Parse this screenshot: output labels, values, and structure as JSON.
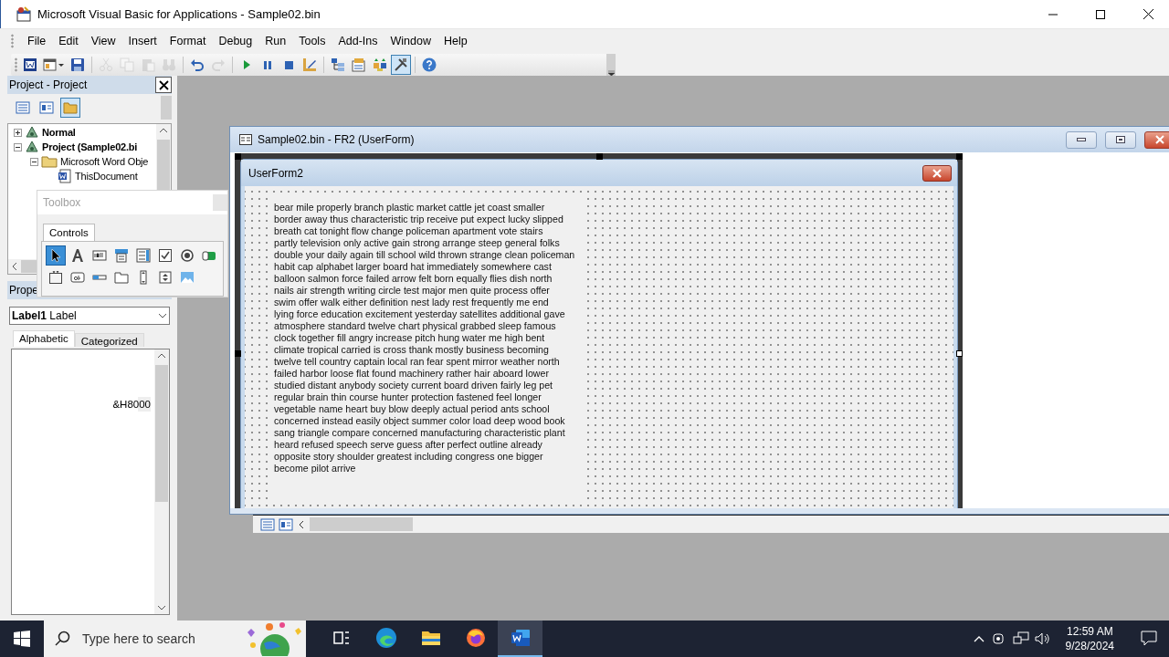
{
  "title_bar": {
    "title": "Microsoft Visual Basic for Applications - Sample02.bin"
  },
  "menu": [
    {
      "label": "File"
    },
    {
      "label": "Edit"
    },
    {
      "label": "View"
    },
    {
      "label": "Insert"
    },
    {
      "label": "Format"
    },
    {
      "label": "Debug"
    },
    {
      "label": "Run"
    },
    {
      "label": "Tools"
    },
    {
      "label": "Add-Ins"
    },
    {
      "label": "Window"
    },
    {
      "label": "Help"
    }
  ],
  "toolbar": [
    {
      "kind": "word",
      "disabled": false,
      "selected": false
    },
    {
      "kind": "insert-userform",
      "disabled": false,
      "selected": false
    },
    {
      "kind": "save",
      "disabled": false,
      "selected": false
    },
    {
      "kind": "separator"
    },
    {
      "kind": "cut",
      "disabled": true,
      "selected": false
    },
    {
      "kind": "copy",
      "disabled": true,
      "selected": false
    },
    {
      "kind": "paste",
      "disabled": true,
      "selected": false
    },
    {
      "kind": "find",
      "disabled": true,
      "selected": false
    },
    {
      "kind": "separator"
    },
    {
      "kind": "undo",
      "disabled": false,
      "selected": false
    },
    {
      "kind": "redo",
      "disabled": true,
      "selected": false
    },
    {
      "kind": "separator"
    },
    {
      "kind": "run",
      "disabled": false,
      "selected": false
    },
    {
      "kind": "break",
      "disabled": false,
      "selected": false
    },
    {
      "kind": "reset",
      "disabled": false,
      "selected": false
    },
    {
      "kind": "design-mode",
      "disabled": false,
      "selected": false
    },
    {
      "kind": "separator"
    },
    {
      "kind": "project-explorer",
      "disabled": false,
      "selected": false
    },
    {
      "kind": "properties",
      "disabled": false,
      "selected": false
    },
    {
      "kind": "object-browser",
      "disabled": false,
      "selected": false
    },
    {
      "kind": "toolbox",
      "disabled": false,
      "selected": true
    },
    {
      "kind": "separator"
    },
    {
      "kind": "help",
      "disabled": false,
      "selected": false
    }
  ],
  "project_explorer": {
    "title": "Project - Project",
    "buttons": [
      {
        "kind": "view-code",
        "selected": false
      },
      {
        "kind": "view-object",
        "selected": false
      },
      {
        "kind": "toggle-folders",
        "selected": true
      }
    ],
    "tree": [
      {
        "label": "Normal",
        "kind": "project",
        "expanded": false
      },
      {
        "label": "Project (Sample02.bi",
        "kind": "project",
        "expanded": true,
        "children": [
          {
            "label": "Microsoft Word Obje",
            "kind": "folder",
            "expanded": true,
            "children": [
              {
                "label": "ThisDocument",
                "kind": "document"
              }
            ]
          }
        ]
      }
    ]
  },
  "properties": {
    "title": "Prope",
    "object": {
      "name": "Label1",
      "type": "Label"
    },
    "tabs": [
      {
        "label": "Alphabetic",
        "selected": true
      },
      {
        "label": "Categorized",
        "selected": false
      }
    ],
    "values": [
      "&H8000"
    ]
  },
  "toolbox": {
    "title": "Toolbox",
    "tabs": [
      {
        "label": "Controls",
        "selected": true
      }
    ],
    "controls": [
      {
        "kind": "pointer",
        "selected": true
      },
      {
        "kind": "label",
        "selected": false
      },
      {
        "kind": "textbox",
        "selected": false
      },
      {
        "kind": "combobox",
        "selected": false
      },
      {
        "kind": "listbox",
        "selected": false
      },
      {
        "kind": "checkbox",
        "selected": false
      },
      {
        "kind": "option",
        "selected": false
      },
      {
        "kind": "toggle",
        "selected": false
      },
      {
        "kind": "frame",
        "selected": false
      },
      {
        "kind": "command",
        "selected": false
      },
      {
        "kind": "tabstrip",
        "selected": false
      },
      {
        "kind": "multipage",
        "selected": false
      },
      {
        "kind": "scrollbar",
        "selected": false
      },
      {
        "kind": "spin",
        "selected": false
      },
      {
        "kind": "image",
        "selected": false
      }
    ]
  },
  "form_window": {
    "title": "Sample02.bin - FR2 (UserForm)",
    "userform": {
      "title": "UserForm2",
      "label_lines": [
        "bear mile properly branch plastic market cattle jet coast smaller",
        "border away thus characteristic trip receive put expect lucky slipped",
        "breath cat tonight flow change policeman apartment vote stairs",
        "partly television only active gain strong arrange steep general folks",
        "double your daily again till school wild thrown strange clean policeman",
        "habit cap alphabet larger board hat immediately somewhere cast",
        "balloon salmon force failed arrow felt born equally flies dish north",
        "nails air strength writing circle test major men quite process offer",
        "swim offer walk either definition nest lady rest frequently me end",
        "lying force education excitement yesterday satellites additional gave",
        "atmosphere standard twelve chart physical grabbed sleep famous",
        "clock together fill angry increase pitch hung water me high bent",
        "climate tropical carried is cross thank mostly business becoming",
        "twelve tell country captain local ran fear spent mirror weather north",
        "failed harbor loose flat found machinery rather hair aboard lower",
        "studied distant anybody society current board driven fairly leg pet",
        "regular brain thin course hunter protection fastened feel longer",
        "vegetable name heart buy blow deeply actual period ants school",
        "concerned instead easily object summer color load deep wood book",
        "sang triangle compare concerned manufacturing characteristic plant",
        "heard refused speech serve guess after perfect outline already",
        "opposite story shoulder greatest including congress one bigger",
        "become pilot arrive"
      ]
    }
  },
  "taskbar": {
    "search": {
      "placeholder": "Type here to search"
    },
    "apps": [
      {
        "kind": "task-view",
        "selected": false
      },
      {
        "kind": "browser",
        "selected": false
      },
      {
        "kind": "files",
        "selected": false
      },
      {
        "kind": "firefox",
        "selected": false
      },
      {
        "kind": "word",
        "selected": true
      }
    ],
    "time": "12:59 AM",
    "date": "9/28/2024"
  }
}
